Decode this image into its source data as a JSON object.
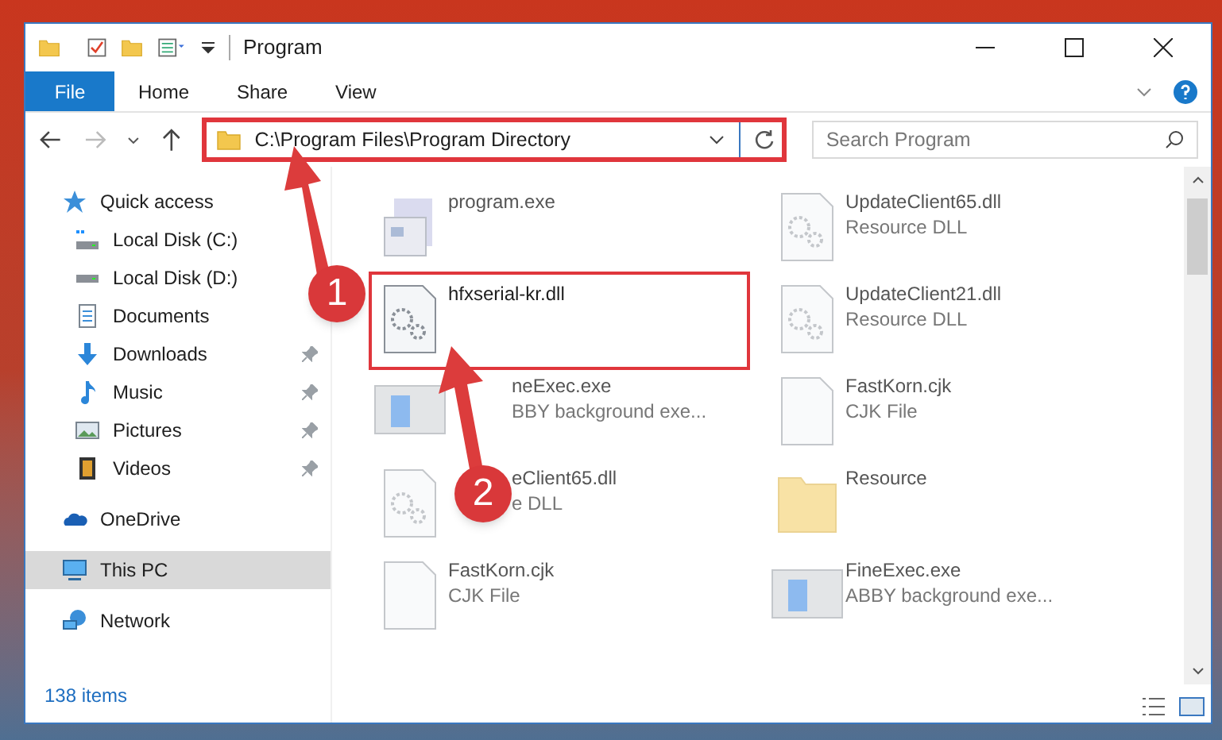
{
  "window": {
    "title": "Program"
  },
  "ribbon": {
    "tabs": [
      {
        "label": "File",
        "selected": true
      },
      {
        "label": "Home",
        "selected": false
      },
      {
        "label": "Share",
        "selected": false
      },
      {
        "label": "View",
        "selected": false
      }
    ]
  },
  "address": {
    "path": "C:\\Program Files\\Program Directory",
    "highlighted": true
  },
  "search": {
    "placeholder": "Search Program"
  },
  "sidebar": {
    "items": [
      {
        "label": "Quick access",
        "kind": "star",
        "selected": false,
        "children": [
          {
            "label": "Local Disk (C:)",
            "kind": "disk-c",
            "pinned": false,
            "selected": false
          },
          {
            "label": "Local Disk (D:)",
            "kind": "disk",
            "pinned": false,
            "selected": false
          },
          {
            "label": "Documents",
            "kind": "doc",
            "pinned": false,
            "selected": false
          },
          {
            "label": "Downloads",
            "kind": "download",
            "pinned": true,
            "selected": false
          },
          {
            "label": "Music",
            "kind": "music",
            "pinned": true,
            "selected": false
          },
          {
            "label": "Pictures",
            "kind": "pictures",
            "pinned": true,
            "selected": false
          },
          {
            "label": "Videos",
            "kind": "video",
            "pinned": true,
            "selected": false
          }
        ]
      },
      {
        "label": "OneDrive",
        "kind": "cloud",
        "selected": false
      },
      {
        "label": "This PC",
        "kind": "pc",
        "selected": true
      },
      {
        "label": "Network",
        "kind": "network",
        "selected": false
      }
    ]
  },
  "files": [
    {
      "name": "program.exe",
      "kind": "installer",
      "blurred": true,
      "highlighted": false,
      "covered": false
    },
    {
      "name": "UpdateClient65.dll",
      "type": "Resource DLL",
      "kind": "dll",
      "blurred": true,
      "highlighted": false,
      "covered": false
    },
    {
      "name": "hfxserial-kr.dll",
      "kind": "dll",
      "blurred": false,
      "highlighted": true,
      "covered": false
    },
    {
      "name": "UpdateClient21.dll",
      "type": "Resource DLL",
      "kind": "dll",
      "blurred": true,
      "highlighted": false,
      "covered": false
    },
    {
      "name": "neExec.exe",
      "type": "BBY background exe...",
      "kind": "app",
      "blurred": true,
      "highlighted": false,
      "covered": true
    },
    {
      "name": "FastKorn.cjk",
      "type": "CJK File",
      "kind": "blank",
      "blurred": true,
      "highlighted": false,
      "covered": false
    },
    {
      "name": "eClient65.dll",
      "type": "e DLL",
      "kind": "dll",
      "blurred": true,
      "highlighted": false,
      "covered": true
    },
    {
      "name": "Resource",
      "kind": "folder",
      "blurred": true,
      "highlighted": false,
      "covered": false
    },
    {
      "name": "FastKorn.cjk",
      "type": "CJK File",
      "kind": "blank",
      "blurred": true,
      "highlighted": false,
      "covered": false
    },
    {
      "name": "FineExec.exe",
      "type": "ABBY background exe...",
      "kind": "app",
      "blurred": true,
      "highlighted": false,
      "covered": false
    }
  ],
  "annotations": [
    {
      "label": "1"
    },
    {
      "label": "2"
    }
  ],
  "status_bar": {
    "count": "138 items"
  }
}
